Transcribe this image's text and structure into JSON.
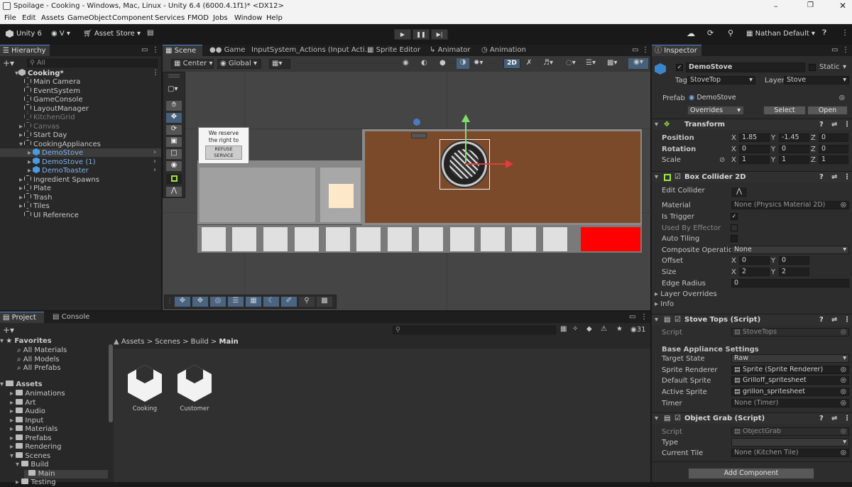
{
  "window": {
    "title": "Spoilage - Cooking - Windows, Mac, Linux - Unity 6.4 (6000.4.1f1)* <DX12>"
  },
  "menu": [
    "File",
    "Edit",
    "Assets",
    "GameObject",
    "Component",
    "Services",
    "FMOD",
    "Jobs",
    "Window",
    "Help"
  ],
  "toolbar": {
    "unity": "Unity 6",
    "account": "V",
    "asset_store": "Asset Store",
    "user": "Nathan Default"
  },
  "hierarchy": {
    "tab": "Hierarchy",
    "search_placeholder": "All",
    "scene": "Cooking*",
    "items": [
      {
        "label": "Main Camera",
        "depth": 1,
        "arrow": false,
        "style": "normal"
      },
      {
        "label": "EventSystem",
        "depth": 1,
        "arrow": false,
        "style": "normal"
      },
      {
        "label": "GameConsole",
        "depth": 1,
        "arrow": false,
        "style": "normal"
      },
      {
        "label": "LayoutManager",
        "depth": 1,
        "arrow": false,
        "style": "normal"
      },
      {
        "label": "KitchenGrid",
        "depth": 1,
        "arrow": false,
        "style": "disabled"
      },
      {
        "label": "Canvas",
        "depth": 1,
        "arrow": true,
        "style": "disabled"
      },
      {
        "label": "Start Day",
        "depth": 1,
        "arrow": true,
        "style": "normal"
      },
      {
        "label": "CookingAppliances",
        "depth": 1,
        "arrow": true,
        "style": "normal",
        "open": true
      },
      {
        "label": "DemoStove",
        "depth": 2,
        "arrow": true,
        "style": "prefab-selected"
      },
      {
        "label": "DemoStove (1)",
        "depth": 2,
        "arrow": true,
        "style": "prefab"
      },
      {
        "label": "DemoToaster",
        "depth": 2,
        "arrow": true,
        "style": "prefab"
      },
      {
        "label": "Ingredient Spawns",
        "depth": 1,
        "arrow": true,
        "style": "normal"
      },
      {
        "label": "Plate",
        "depth": 1,
        "arrow": true,
        "style": "normal"
      },
      {
        "label": "Trash",
        "depth": 1,
        "arrow": true,
        "style": "normal"
      },
      {
        "label": "Tiles",
        "depth": 1,
        "arrow": true,
        "style": "normal"
      },
      {
        "label": "UI Reference",
        "depth": 1,
        "arrow": false,
        "style": "normal"
      }
    ]
  },
  "scene_tabs": [
    "Scene",
    "Game",
    "InputSystem_Actions (Input Acti...",
    "Sprite Editor",
    "Animator",
    "Animation"
  ],
  "scene_toolbar": {
    "pivot": "Center",
    "space": "Global",
    "mode2d": "2D"
  },
  "scene_content": {
    "sign_line1": "We reserve",
    "sign_line2": "the right to",
    "sign_button": "REFUSE SERVICE"
  },
  "project": {
    "tabs": [
      "Project",
      "Console"
    ],
    "count": "31",
    "breadcrumb": [
      "Assets",
      "Scenes",
      "Build",
      "Main"
    ],
    "favorites_label": "Favorites",
    "favorites": [
      "All Materials",
      "All Models",
      "All Prefabs"
    ],
    "assets_label": "Assets",
    "folders": [
      {
        "label": "Animations",
        "depth": 1
      },
      {
        "label": "Art",
        "depth": 1
      },
      {
        "label": "Audio",
        "depth": 1
      },
      {
        "label": "Input",
        "depth": 1
      },
      {
        "label": "Materials",
        "depth": 1
      },
      {
        "label": "Prefabs",
        "depth": 1
      },
      {
        "label": "Rendering",
        "depth": 1
      },
      {
        "label": "Scenes",
        "depth": 1
      },
      {
        "label": "Build",
        "depth": 2
      },
      {
        "label": "Main",
        "depth": 3
      },
      {
        "label": "Testing",
        "depth": 2
      }
    ],
    "files": [
      "Cooking",
      "Customer"
    ]
  },
  "inspector": {
    "tab": "Inspector",
    "object_name": "DemoStove",
    "static_label": "Static",
    "tag_label": "Tag",
    "tag": "StoveTop",
    "layer_label": "Layer",
    "layer": "Stove",
    "prefab_label": "Prefab",
    "prefab": "DemoStove",
    "overrides": "Overrides",
    "select": "Select",
    "open": "Open",
    "transform": {
      "title": "Transform",
      "position": {
        "label": "Position",
        "x": "1.85",
        "y": "-1.45",
        "z": "0"
      },
      "rotation": {
        "label": "Rotation",
        "x": "0",
        "y": "0",
        "z": "0"
      },
      "scale": {
        "label": "Scale",
        "x": "1",
        "y": "1",
        "z": "1"
      }
    },
    "box_collider": {
      "title": "Box Collider 2D",
      "edit_collider": "Edit Collider",
      "material_label": "Material",
      "material": "None (Physics Material 2D)",
      "is_trigger": "Is Trigger",
      "used_by_effector": "Used By Effector",
      "auto_tiling": "Auto Tiling",
      "composite_label": "Composite Operation",
      "composite": "None",
      "offset": {
        "label": "Offset",
        "x": "0",
        "y": "0"
      },
      "size": {
        "label": "Size",
        "x": "2",
        "y": "2"
      },
      "edge_radius": {
        "label": "Edge Radius",
        "value": "0"
      },
      "layer_overrides": "Layer Overrides",
      "info": "Info"
    },
    "stove_tops": {
      "title": "Stove Tops (Script)",
      "script_label": "Script",
      "script": "StoveTops",
      "section": "Base Appliance Settings",
      "target_state_label": "Target State",
      "target_state": "Raw",
      "sprite_renderer_label": "Sprite Renderer",
      "sprite_renderer": "Sprite (Sprite Renderer)",
      "default_sprite_label": "Default Sprite",
      "default_sprite": "Grilloff_spritesheet",
      "active_sprite_label": "Active Sprite",
      "active_sprite": "grillon_spritesheet",
      "timer_label": "Timer",
      "timer": "None (Timer)"
    },
    "object_grab": {
      "title": "Object Grab (Script)",
      "script_label": "Script",
      "script": "ObjectGrab",
      "type_label": "Type",
      "type": "",
      "current_tile_label": "Current Tile",
      "current_tile": "None (Kitchen Tile)"
    },
    "add_component": "Add Component"
  },
  "colors": {
    "accent": "#4a88d1",
    "selected": "#2c5d87",
    "prefab_text": "#7fb3ea",
    "counter_wood": "#7a4a2a",
    "red_tile": "#ff0000"
  }
}
